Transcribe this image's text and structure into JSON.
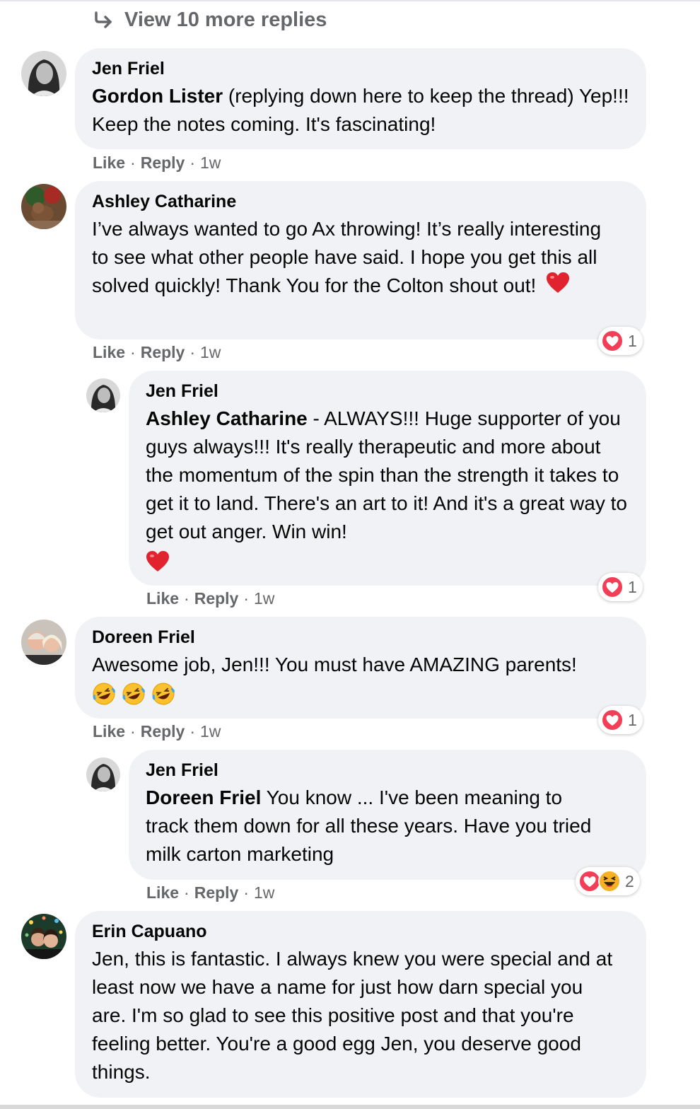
{
  "view_more": {
    "label": "View 10 more replies",
    "icon": "reply-arrow-icon"
  },
  "comments": [
    {
      "author": "Jen Friel",
      "mention": "Gordon Lister",
      "text": " (replying down here to keep the thread) Yep!!! Keep the notes coming. It's fascinating!",
      "like": "Like",
      "reply": "Reply",
      "time": "1w"
    },
    {
      "author": "Ashley Catharine",
      "text": "I’ve always wanted to go Ax throwing! It’s really interesting to see what other people have said. I hope you get this all solved quickly! Thank You for the Colton shout out!",
      "emoji": "heart",
      "like": "Like",
      "reply": "Reply",
      "time": "1w",
      "reaction_count": "1",
      "reaction_icons": [
        "love"
      ]
    },
    {
      "author": "Jen Friel",
      "mention": "Ashley Catharine",
      "text": " - ALWAYS!!! Huge supporter of you guys always!!! It's really therapeutic and more about the momentum of the spin than the strength it takes to get it to land. There's an art to it! And it's a great way to get out anger. Win win!",
      "emoji": "heart",
      "like": "Like",
      "reply": "Reply",
      "time": "1w",
      "reaction_count": "1",
      "reaction_icons": [
        "love"
      ]
    },
    {
      "author": "Doreen Friel",
      "text": "Awesome job, Jen!!! You must have AMAZING parents!",
      "emoji": "rofl x3",
      "like": "Like",
      "reply": "Reply",
      "time": "1w",
      "reaction_count": "1",
      "reaction_icons": [
        "love"
      ]
    },
    {
      "author": "Jen Friel",
      "mention": "Doreen Friel",
      "text": " You know ... I've been meaning to track them down for all these years. Have you tried milk carton marketing",
      "like": "Like",
      "reply": "Reply",
      "time": "1w",
      "reaction_count": "2",
      "reaction_icons": [
        "love",
        "haha"
      ]
    },
    {
      "author": "Erin Capuano",
      "text": "Jen, this is fantastic. I always knew you were special and at least now we have a name for just how darn special you are. I'm so glad to see this positive post and that you're feeling better. You're a good egg Jen, you deserve good things."
    }
  ],
  "colors": {
    "bubble": "#f0f2f5",
    "meta": "#65676b",
    "love": "#f33e58",
    "haha": "#f7b125"
  }
}
